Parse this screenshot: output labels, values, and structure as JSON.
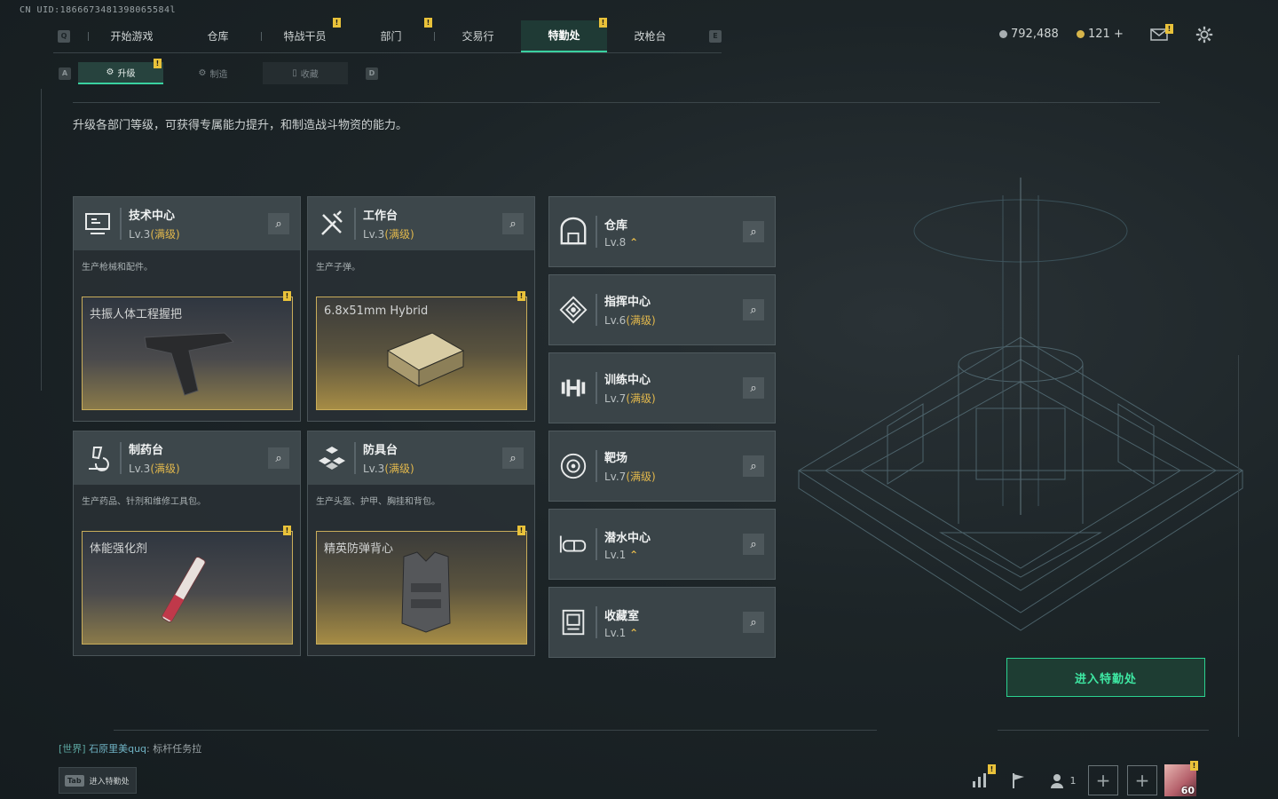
{
  "uid": "CN UID:1866673481398065584l",
  "nav": {
    "left_key": "Q",
    "right_key": "E",
    "items": [
      {
        "label": "开始游戏",
        "active": false
      },
      {
        "label": "仓库",
        "active": false
      },
      {
        "label": "特战干员",
        "active": false
      },
      {
        "label": "部门",
        "active": false
      },
      {
        "label": "交易行",
        "active": false
      },
      {
        "label": "特勤处",
        "active": true
      },
      {
        "label": "改枪台",
        "active": false
      }
    ]
  },
  "currency": {
    "silver": "792,488",
    "gold": "121 +"
  },
  "warn_glyph": "!",
  "subnav": {
    "left_key": "A",
    "right_key": "D",
    "tabs": [
      {
        "label": "升级",
        "active": true
      },
      {
        "label": "制造",
        "active": false
      },
      {
        "label": "收藏",
        "active": false
      }
    ]
  },
  "description": "升级各部门等级，可获得专属能力提升，和制造战斗物资的能力。",
  "production_cards": [
    {
      "name": "技术中心",
      "level": "Lv.3",
      "status": "(满级)",
      "desc": "生产枪械和配件。",
      "item": "共振人体工程握把",
      "icon": "monitor-icon"
    },
    {
      "name": "工作台",
      "level": "Lv.3",
      "status": "(满级)",
      "desc": "生产子弹。",
      "item": "6.8x51mm Hybrid",
      "icon": "tools-icon"
    },
    {
      "name": "制药台",
      "level": "Lv.3",
      "status": "(满级)",
      "desc": "生产药品、针剂和维修工具包。",
      "item": "体能强化剂",
      "icon": "microscope-icon"
    },
    {
      "name": "防具台",
      "level": "Lv.3",
      "status": "(满级)",
      "desc": "生产头盔、护甲、胸挂和背包。",
      "item": "精英防弹背心",
      "icon": "armor-blocks-icon"
    }
  ],
  "facility_cards": [
    {
      "name": "仓库",
      "level": "Lv.8",
      "status": "",
      "upgradable": true,
      "icon": "warehouse-icon"
    },
    {
      "name": "指挥中心",
      "level": "Lv.6",
      "status": "(满级)",
      "upgradable": false,
      "icon": "command-icon"
    },
    {
      "name": "训练中心",
      "level": "Lv.7",
      "status": "(满级)",
      "upgradable": false,
      "icon": "dumbbell-icon"
    },
    {
      "name": "靶场",
      "level": "Lv.7",
      "status": "(满级)",
      "upgradable": false,
      "icon": "target-icon"
    },
    {
      "name": "潜水中心",
      "level": "Lv.1",
      "status": "",
      "upgradable": true,
      "icon": "diving-mask-icon"
    },
    {
      "name": "收藏室",
      "level": "Lv.1",
      "status": "",
      "upgradable": true,
      "icon": "collection-icon"
    }
  ],
  "upgrade_glyph": "⌃",
  "enter_button": "进入特勤处",
  "chat": {
    "channel": "[世界]",
    "user": "石原里美quq",
    "message": "标杆任务拉"
  },
  "tab_hint": {
    "key": "Tab",
    "label": "进入特勤处"
  },
  "bottom": {
    "friends_count": "1",
    "player_level": "60"
  }
}
